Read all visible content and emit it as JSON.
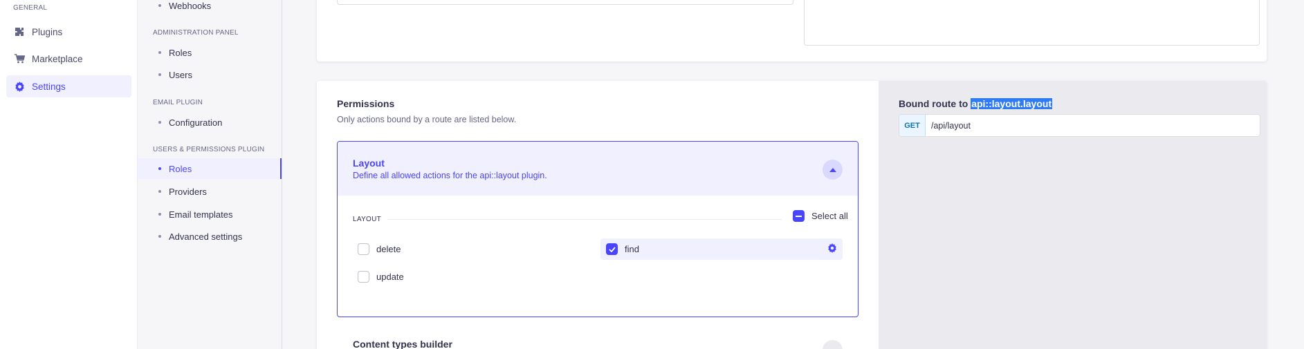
{
  "mainnav": {
    "section": "GENERAL",
    "items": [
      {
        "label": "Plugins",
        "icon": "puzzle-icon"
      },
      {
        "label": "Marketplace",
        "icon": "cart-icon"
      },
      {
        "label": "Settings",
        "icon": "gear-icon",
        "active": true
      }
    ]
  },
  "subnav": {
    "top_item": "Webhooks",
    "sections": [
      {
        "title": "ADMINISTRATION PANEL",
        "items": [
          "Roles",
          "Users"
        ]
      },
      {
        "title": "EMAIL PLUGIN",
        "items": [
          "Configuration"
        ]
      },
      {
        "title": "USERS & PERMISSIONS PLUGIN",
        "items": [
          "Roles",
          "Providers",
          "Email templates",
          "Advanced settings"
        ],
        "active_index": 0
      }
    ]
  },
  "permissions": {
    "title": "Permissions",
    "subtitle": "Only actions bound by a route are listed below.",
    "accordion": {
      "title": "Layout",
      "description": "Define all allowed actions for the api::layout plugin.",
      "group_label": "LAYOUT",
      "select_all_label": "Select all",
      "actions": [
        {
          "label": "delete",
          "checked": false
        },
        {
          "label": "find",
          "checked": true
        },
        {
          "label": "update",
          "checked": false
        }
      ]
    },
    "next_accordion_title": "Content types builder"
  },
  "route": {
    "label_prefix": "Bound route to",
    "label_highlight": "api::layout.layout",
    "method": "GET",
    "path": "/api/layout"
  },
  "colors": {
    "primary": "#4945ff",
    "primary_light": "#f0f0ff",
    "selection": "#2f7bf5"
  }
}
